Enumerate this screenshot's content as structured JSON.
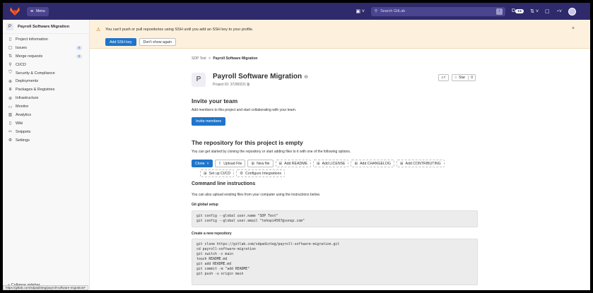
{
  "navbar": {
    "menu_label": "Menu",
    "search_placeholder": "Search GitLab",
    "search_shortcut": "/",
    "merge_count": "0"
  },
  "sidebar": {
    "project_initial": "P",
    "project_name": "Payroll Software Migration",
    "items": [
      {
        "label": "Project information",
        "icon": "project-info-icon",
        "glyph": "▯"
      },
      {
        "label": "Issues",
        "icon": "issues-icon",
        "glyph": "▢",
        "count": "0"
      },
      {
        "label": "Merge requests",
        "icon": "merge-requests-icon",
        "glyph": "⇅",
        "count": "0"
      },
      {
        "label": "CI/CD",
        "icon": "rocket-icon",
        "glyph": "⚲"
      },
      {
        "label": "Security & Compliance",
        "icon": "shield-icon",
        "glyph": "⛉"
      },
      {
        "label": "Deployments",
        "icon": "deployments-icon",
        "glyph": "⊕"
      },
      {
        "label": "Packages & Registries",
        "icon": "package-icon",
        "glyph": "⧈"
      },
      {
        "label": "Infrastructure",
        "icon": "infrastructure-icon",
        "glyph": "⊛"
      },
      {
        "label": "Monitor",
        "icon": "monitor-icon",
        "glyph": "▭"
      },
      {
        "label": "Analytics",
        "icon": "analytics-icon",
        "glyph": "▥"
      },
      {
        "label": "Wiki",
        "icon": "wiki-icon",
        "glyph": "▯"
      },
      {
        "label": "Snippets",
        "icon": "snippets-icon",
        "glyph": "✂"
      },
      {
        "label": "Settings",
        "icon": "gear-icon",
        "glyph": "⚙"
      }
    ],
    "collapse_label": "Collapse sidebar"
  },
  "statusbar": {
    "url": "https://gitlab.com/sdpadinteg/payroll-software-migration#"
  },
  "alert": {
    "message": "You can't push or pull repositories using SSH until you add an SSH key to your profile.",
    "add_key_label": "Add SSH key",
    "dismiss_label": "Don't show again"
  },
  "breadcrumb": {
    "parent": "SDP Test",
    "separator": ">",
    "current": "Payroll Software Migration"
  },
  "project": {
    "initial": "P",
    "title": "Payroll Software Migration",
    "id_text": "Project ID: 37280231",
    "star_label": "Star",
    "star_count": "0"
  },
  "invite": {
    "heading": "Invite your team",
    "text": "Add members to this project and start collaborating with your team.",
    "button": "Invite members"
  },
  "empty_repo": {
    "heading": "The repository for this project is empty",
    "text": "You can get started by cloning the repository or start adding files to it with one of the following options.",
    "clone_label": "Clone",
    "actions_row1": [
      {
        "label": "Upload File",
        "icon": "upload-icon",
        "glyph": "⇪",
        "dashed": false
      },
      {
        "label": "New file",
        "icon": "file-plus-icon",
        "glyph": "⊞",
        "dashed": false
      },
      {
        "label": "Add README",
        "icon": "plus-square-icon",
        "glyph": "⊞",
        "dashed": true
      },
      {
        "label": "Add LICENSE",
        "icon": "plus-square-icon",
        "glyph": "⊞",
        "dashed": true
      },
      {
        "label": "Add CHANGELOG",
        "icon": "plus-square-icon",
        "glyph": "⊞",
        "dashed": true
      },
      {
        "label": "Add CONTRIBUTING",
        "icon": "plus-square-icon",
        "glyph": "⊞",
        "dashed": true
      }
    ],
    "actions_row2": [
      {
        "label": "Set up CI/CD",
        "icon": "plus-square-icon",
        "glyph": "⊞",
        "dashed": true
      },
      {
        "label": "Configure Integrations",
        "icon": "gear-icon",
        "glyph": "⚙",
        "dashed": true
      }
    ]
  },
  "cli": {
    "heading": "Command line instructions",
    "text": "You can also upload existing files from your computer using the instructions below.",
    "global_heading": "Git global setup",
    "global_code": "git config --global user.name \"SDP Test\"\ngit config --global user.email \"tehopi4567@sonqz.com\"",
    "new_repo_heading": "Create a new repository",
    "new_repo_code": "git clone https://gitlab.com/sdpadinteg/payroll-software-migration.git\ncd payroll-software-migration\ngit switch -c main\ntouch README.md\ngit add README.md\ngit commit -m \"add README\"\ngit push -u origin main"
  }
}
